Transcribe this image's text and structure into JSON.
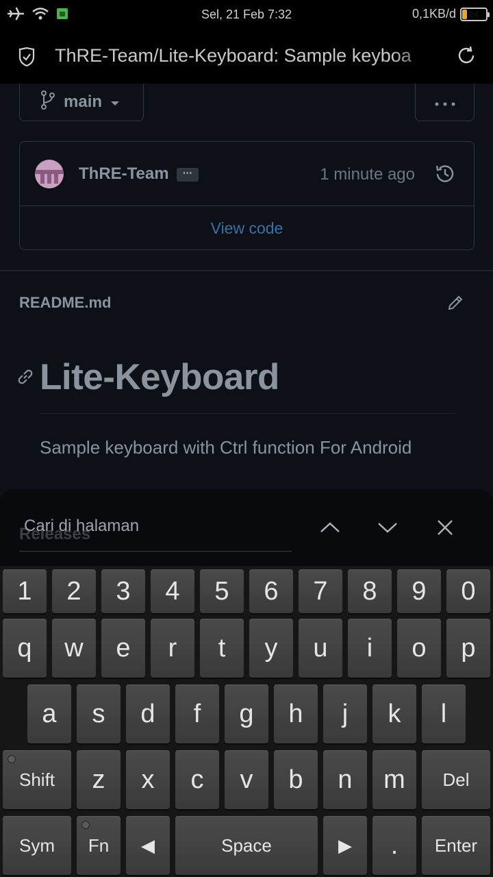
{
  "status_bar": {
    "datetime": "Sel, 21 Feb 7:32",
    "net_speed": "0,1KB/d",
    "battery": "24",
    "battery_level_percent": 24
  },
  "browser": {
    "url_title": "ThRE-Team/Lite-Keyboard: Sample keyboa"
  },
  "repo": {
    "branch": "main",
    "commit_author": "ThRE-Team",
    "commit_ellipsis": "···",
    "commit_time": "1 minute ago",
    "view_code": "View code",
    "readme_file": "README.md",
    "title": "Lite-Keyboard",
    "description": "Sample keyboard with Ctrl function For Android",
    "next_section": "Releases"
  },
  "find_in_page": {
    "placeholder": "Cari di halaman"
  },
  "keyboard": {
    "row1": [
      "1",
      "2",
      "3",
      "4",
      "5",
      "6",
      "7",
      "8",
      "9",
      "0"
    ],
    "row2": [
      "q",
      "w",
      "e",
      "r",
      "t",
      "y",
      "u",
      "i",
      "o",
      "p"
    ],
    "row3": [
      "a",
      "s",
      "d",
      "f",
      "g",
      "h",
      "j",
      "k",
      "l"
    ],
    "row4": {
      "shift": "Shift",
      "letters": [
        "z",
        "x",
        "c",
        "v",
        "b",
        "n",
        "m"
      ],
      "del": "Del"
    },
    "row5": {
      "sym": "Sym",
      "fn": "Fn",
      "left": "◀",
      "space": "Space",
      "right": "▶",
      "period": ".",
      "enter": "Enter"
    }
  }
}
